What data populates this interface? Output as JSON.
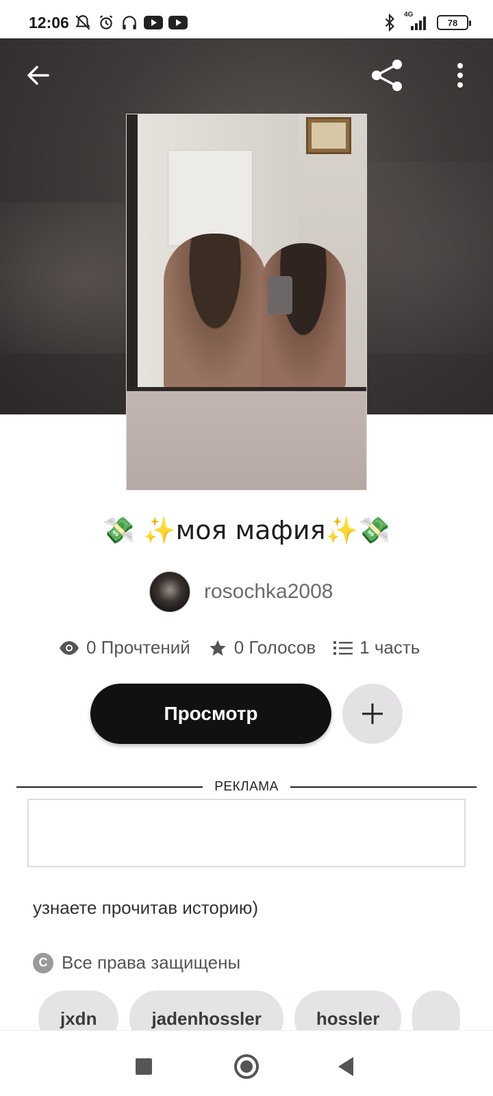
{
  "status_bar": {
    "time": "12:06",
    "network": "4G",
    "battery": "78",
    "icons": [
      "notifications-off-icon",
      "alarm-icon",
      "headphones-icon",
      "youtube-icon",
      "youtube-icon",
      "bluetooth-icon",
      "signal-icon",
      "battery-icon"
    ]
  },
  "header": {
    "back_icon": "arrow-left-icon",
    "share_icon": "share-icon",
    "more_icon": "more-vertical-icon"
  },
  "story": {
    "title": "💸 ✨моя мафия✨💸",
    "author": "rosochka2008",
    "stats": {
      "reads": "0 Прочтений",
      "votes": "0 Голосов",
      "parts": "1 часть"
    },
    "view_button": "Просмотр",
    "add_button_icon": "plus-icon",
    "description": "узнаете прочитав историю)",
    "copyright": "Все права защищены",
    "tags": [
      "jxdn",
      "jadenhossler",
      "hossler",
      ""
    ]
  },
  "ad": {
    "label": "РЕКЛАМА"
  },
  "colors": {
    "primary_button": "#121012",
    "secondary_button": "#e3e1e3",
    "tag_bg": "#e5e3e5",
    "hero_bg": "#3f3a39"
  }
}
